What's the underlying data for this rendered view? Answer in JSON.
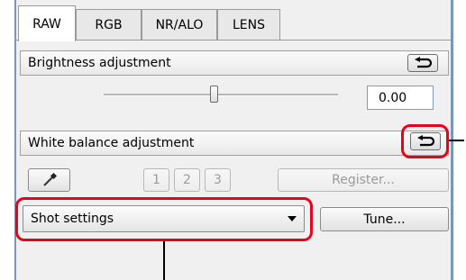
{
  "tabs": [
    {
      "label": "RAW",
      "active": true
    },
    {
      "label": "RGB",
      "active": false
    },
    {
      "label": "NR/ALO",
      "active": false
    },
    {
      "label": "LENS",
      "active": false
    }
  ],
  "brightness": {
    "title": "Brightness adjustment",
    "value": "0.00",
    "slider_level": 0.5
  },
  "white_balance": {
    "title": "White balance adjustment",
    "eyedropper_icon": "eyedropper-icon",
    "presets": [
      "1",
      "2",
      "3"
    ],
    "register_label": "Register...",
    "selected": "Shot settings",
    "tune_label": "Tune..."
  },
  "icons": {
    "reset": "undo-arrow-icon"
  },
  "colors": {
    "highlight": "#e2061b",
    "panel_border": "#7a96b8"
  }
}
